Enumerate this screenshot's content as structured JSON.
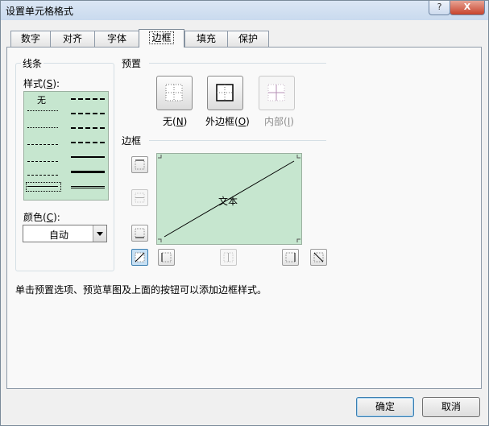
{
  "window": {
    "title": "设置单元格格式",
    "help_label": "?",
    "close_label": "X"
  },
  "tabs": [
    "数字",
    "对齐",
    "字体",
    "边框",
    "填充",
    "保护"
  ],
  "active_tab": "边框",
  "line_group": {
    "title": "线条",
    "style_label_prefix": "样式(",
    "style_label_key": "S",
    "style_label_suffix": "):",
    "none_style_label": "无",
    "color_label_prefix": "颜色(",
    "color_label_key": "C",
    "color_label_suffix": "):",
    "color_value": "自动"
  },
  "presets": {
    "title": "预置",
    "none": {
      "prefix": "无(",
      "key": "N",
      "suffix": ")"
    },
    "outline": {
      "prefix": "外边框(",
      "key": "O",
      "suffix": ")"
    },
    "inside": {
      "prefix": "内部(",
      "key": "I",
      "suffix": ")"
    }
  },
  "border": {
    "title": "边框",
    "preview_text": "文本"
  },
  "hint": "单击预置选项、预览草图及上面的按钮可以添加边框样式。",
  "buttons": {
    "ok": "确定",
    "cancel": "取消"
  },
  "colors": {
    "accent": "#3c7fb1",
    "preview_bg": "#c6e6cf",
    "close_red": "#c7432c"
  }
}
